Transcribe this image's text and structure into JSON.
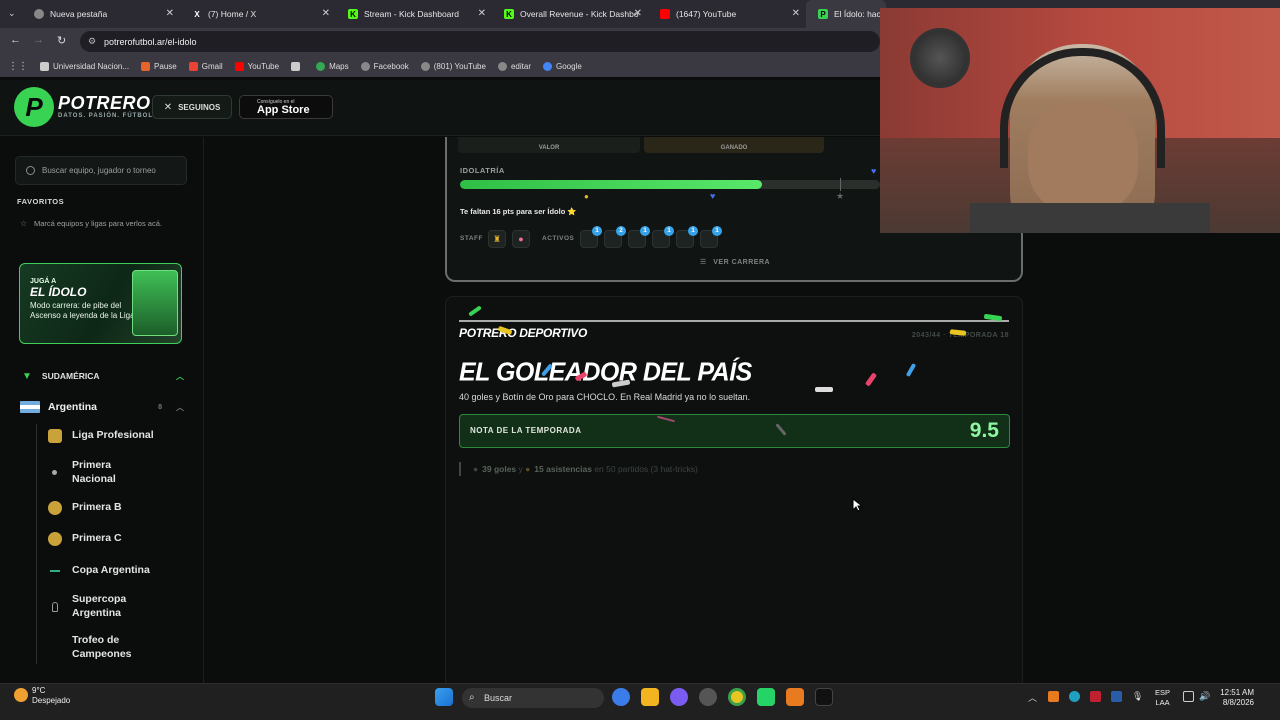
{
  "browser": {
    "tabs": [
      {
        "label": "Nueva pestaña",
        "icon": "chrome-icon",
        "color": "#888888"
      },
      {
        "label": "(7) Home / X",
        "icon": "x-icon",
        "color": "#ffffff"
      },
      {
        "label": "Stream - Kick Dashboard",
        "icon": "kick-icon",
        "color": "#53fc18"
      },
      {
        "label": "Overall Revenue - Kick Dashbo",
        "icon": "kick-icon",
        "color": "#53fc18"
      },
      {
        "label": "(1647) YouTube",
        "icon": "youtube-icon",
        "color": "#ff0000"
      },
      {
        "label": "El Ídolo: hacé",
        "icon": "potrero-icon",
        "color": "#39d353"
      }
    ],
    "url": "potrerofutbol.ar/el-idolo",
    "bookmarks": [
      {
        "label": "Universidad Nacion...",
        "color": "#cccccc"
      },
      {
        "label": "Pause",
        "color": "#e8632b"
      },
      {
        "label": "Gmail",
        "color": "#ea4335"
      },
      {
        "label": "YouTube",
        "color": "#ff0000"
      },
      {
        "label": "",
        "color": "#cccccc"
      },
      {
        "label": "Maps",
        "color": "#34a853"
      },
      {
        "label": "Facebook",
        "color": "#888888"
      },
      {
        "label": "(801) YouTube",
        "color": "#888888"
      },
      {
        "label": "editar",
        "color": "#888888"
      },
      {
        "label": "Google",
        "color": "#4285f4"
      }
    ]
  },
  "header": {
    "logo_letter": "P",
    "logo_name": "POTRERO",
    "logo_tagline": "DATOS. PASIÓN. FÚTBOL.",
    "follow_label": "SEGUINOS",
    "appstore_small": "Consíguelo en el",
    "appstore_big": "App Store"
  },
  "sidebar": {
    "search_placeholder": "Buscar equipo, jugador o torneo",
    "favorites_heading": "FAVORITOS",
    "favorites_note": "Marcá equipos y ligas para verlos acá.",
    "promo": {
      "kicker": "JUGÁ A",
      "title": "EL ÍDOLO",
      "desc": "Modo carrera: de pibe del Ascenso a leyenda de la Liga"
    },
    "region": "SUDAMÉRICA",
    "country": "Argentina",
    "country_count": "8",
    "leagues": [
      {
        "label": "Liga Profesional",
        "color": "#c9a23a"
      },
      {
        "label": "Primera Nacional",
        "color": "#0b0d0c"
      },
      {
        "label": "Primera B",
        "color": "#c9a23a"
      },
      {
        "label": "Primera C",
        "color": "#c9a23a"
      },
      {
        "label": "Copa Argentina",
        "color": "#0b0d0c"
      },
      {
        "label": "Supercopa Argentina",
        "color": "#0b0d0c"
      },
      {
        "label": "Trofeo de Campeones",
        "color": "#0b0d0c"
      }
    ]
  },
  "career_card": {
    "stat_labels": [
      "VALOR",
      "GANADO"
    ],
    "idolatry_label": "IDOLATRÍA",
    "idolatry_fraction": 0.72,
    "points_text": "Te faltan 16 pts para ser Ídolo ⭐",
    "staff_label": "STAFF",
    "active_label": "ACTIVOS",
    "active_badges": [
      "1",
      "2",
      "1",
      "1",
      "1",
      "1",
      "1"
    ],
    "see_career": "VER CARRERA"
  },
  "news": {
    "masthead": "POTRERO DEPORTIVO",
    "season": "2043/44 · TEMPORADA 18",
    "headline": "EL GOLEADOR DEL PAÍS",
    "subhead": "40 goles y Botín de Oro para CHOCLO. En Real Madrid ya no lo sueltan.",
    "rating_label": "NOTA DE LA TEMPORADA",
    "rating_value": "9.5",
    "stat_goals": "39 goles",
    "stat_and": " y ",
    "stat_assists": "15 asistencias",
    "stat_rest": " en 50 partidos (3 hat-tricks)"
  },
  "taskbar": {
    "temp": "9°C",
    "weather": "Despejado",
    "search": "Buscar",
    "lang_top": "ESP",
    "lang_bottom": "LAA",
    "time": "12:51 AM",
    "date": "8/8/2026"
  },
  "colors": {
    "accent": "#39d353",
    "progress": "#4fdf60",
    "rating_value": "#8ff5a0"
  }
}
